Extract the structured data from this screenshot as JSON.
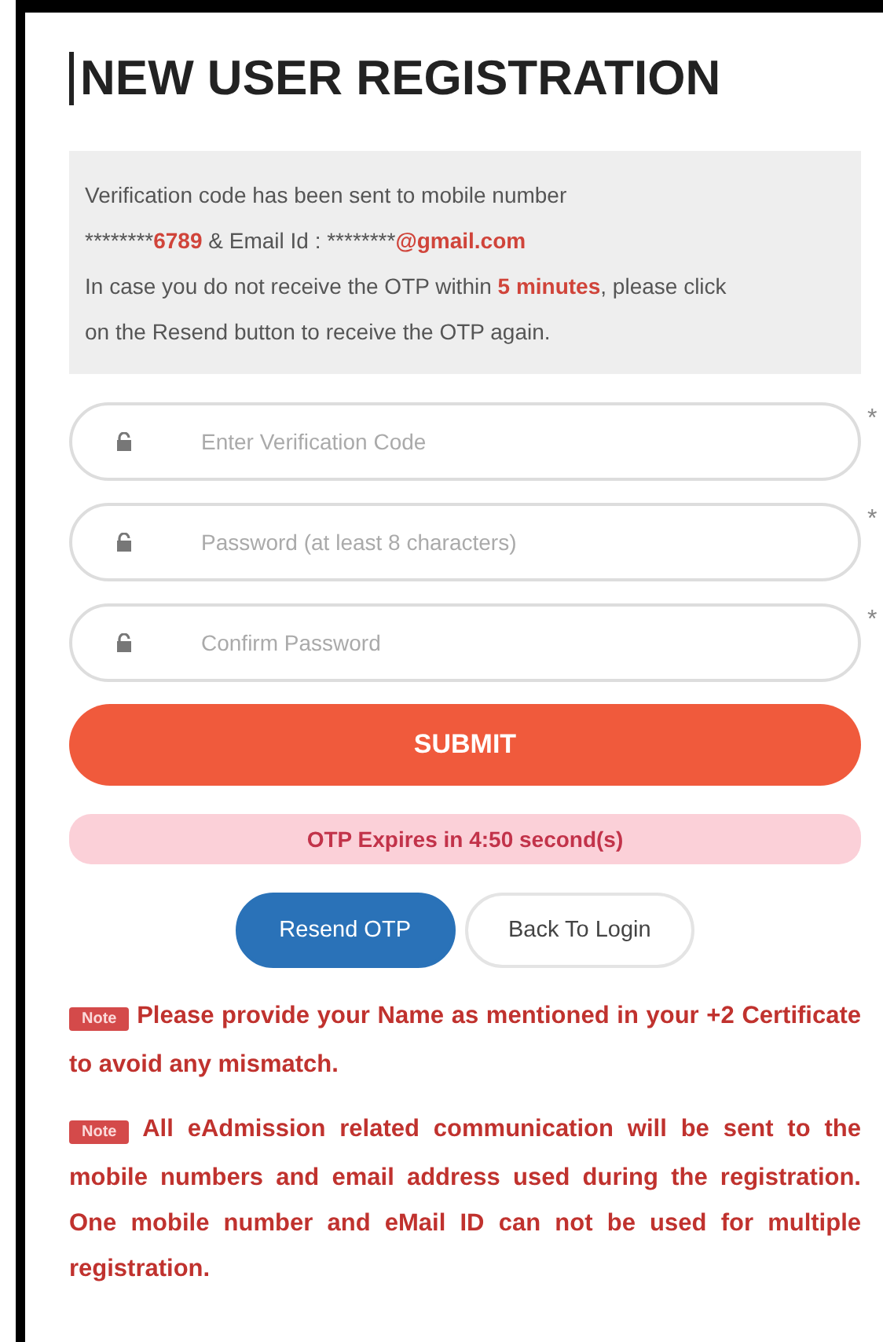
{
  "title": "NEW USER REGISTRATION",
  "info": [
    [
      {
        "text": "Verification code has been sent to mobile number",
        "highlight": false
      }
    ],
    [
      {
        "text": "********",
        "highlight": false
      },
      {
        "text": "6789",
        "highlight": true
      },
      {
        "text": " & Email Id : ********",
        "highlight": false
      },
      {
        "text": "@gmail.com",
        "highlight": true
      }
    ],
    [
      {
        "text": "In case you do not receive the OTP within ",
        "highlight": false
      },
      {
        "text": "5 minutes",
        "highlight": true
      },
      {
        "text": ", please click on the Resend button to receive the OTP again.",
        "highlight": false
      }
    ]
  ],
  "fields": [
    {
      "placeholder": "Enter Verification Code",
      "required": "*"
    },
    {
      "placeholder": "Password (at least 8 characters)",
      "required": "*"
    },
    {
      "placeholder": "Confirm Password",
      "required": "*"
    }
  ],
  "submit": "SUBMIT",
  "timer": "OTP Expires in 4:50 second(s)",
  "buttons": [
    {
      "label": "Resend OTP",
      "kind": "primary"
    },
    {
      "label": "Back To Login",
      "kind": "plain"
    }
  ],
  "notes": [
    {
      "badge": "Note",
      "text": "Please provide your Name as mentioned in your +2 Certificate to avoid any mismatch."
    },
    {
      "badge": "Note",
      "text": "All eAdmission related communication will be sent to the mobile numbers and email address used during the registration. One mobile number and eMail ID can not be used for multiple registration."
    }
  ]
}
